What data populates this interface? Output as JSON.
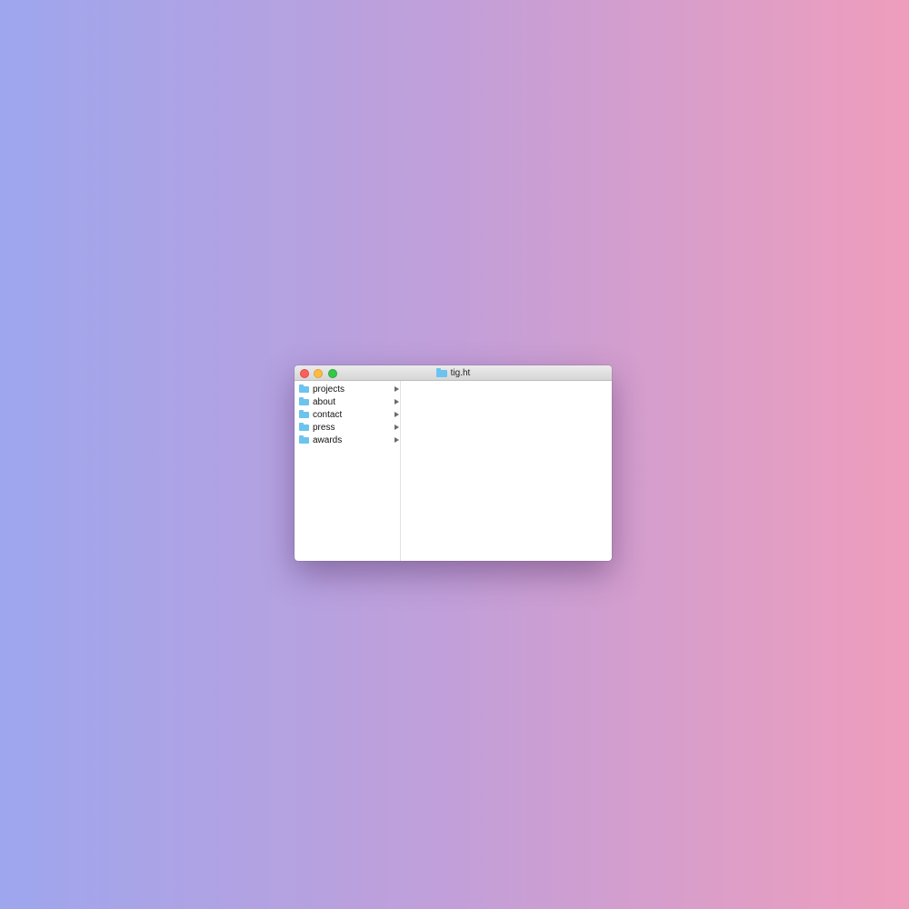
{
  "window": {
    "title": "tig.ht"
  },
  "sidebar": {
    "items": [
      {
        "label": "projects"
      },
      {
        "label": "about"
      },
      {
        "label": "contact"
      },
      {
        "label": "press"
      },
      {
        "label": "awards"
      }
    ]
  },
  "icons": {
    "folder": "folder-icon",
    "disclosure": "chevron-right-icon"
  },
  "colors": {
    "background_left": "#9ea6ee",
    "background_right": "#ef9dbc",
    "folder": "#6cc3ee",
    "close": "#fc605c",
    "minimize": "#fdbc40",
    "zoom": "#34c84a"
  }
}
